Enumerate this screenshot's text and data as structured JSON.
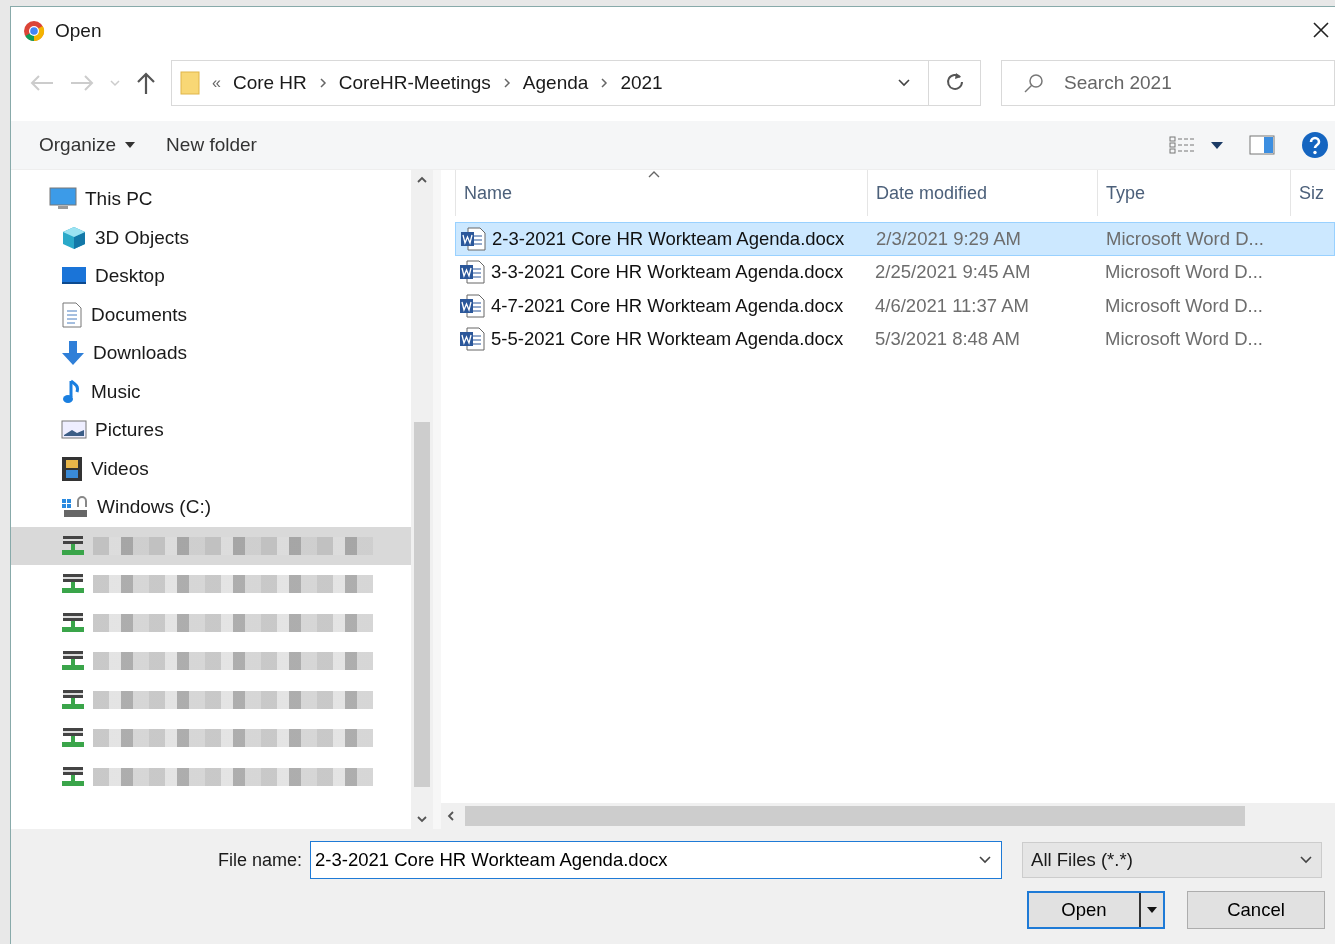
{
  "window": {
    "title": "Open"
  },
  "address": {
    "overflow": "«",
    "crumbs": [
      "Core HR",
      "CoreHR-Meetings",
      "Agenda",
      "2021"
    ]
  },
  "search": {
    "placeholder": "Search 2021"
  },
  "toolbar": {
    "organize": "Organize",
    "new_folder": "New folder"
  },
  "nav_pane": {
    "tree": [
      {
        "label": "This PC",
        "kind": "pc",
        "selected": false,
        "children": [
          {
            "label": "3D Objects",
            "kind": "cube",
            "selected": false
          },
          {
            "label": "Desktop",
            "kind": "desktop",
            "selected": false
          },
          {
            "label": "Documents",
            "kind": "document",
            "selected": false
          },
          {
            "label": "Downloads",
            "kind": "download",
            "selected": false
          },
          {
            "label": "Music",
            "kind": "music",
            "selected": false
          },
          {
            "label": "Pictures",
            "kind": "picture",
            "selected": false
          },
          {
            "label": "Videos",
            "kind": "video",
            "selected": false
          },
          {
            "label": "Windows (C:)",
            "kind": "disk",
            "selected": false
          },
          {
            "kind": "network-drive",
            "redacted": true,
            "selected": true
          },
          {
            "kind": "network-drive",
            "redacted": true,
            "selected": false
          },
          {
            "kind": "network-drive",
            "redacted": true,
            "selected": false
          },
          {
            "kind": "network-drive",
            "redacted": true,
            "selected": false
          },
          {
            "kind": "network-drive",
            "redacted": true,
            "selected": false
          },
          {
            "kind": "network-drive",
            "redacted": true,
            "selected": false
          },
          {
            "kind": "network-drive",
            "redacted": true,
            "selected": false
          }
        ]
      }
    ]
  },
  "files": {
    "columns": [
      "Name",
      "Date modified",
      "Type",
      "Siz"
    ],
    "rows": [
      {
        "name": "2-3-2021 Core HR Workteam Agenda.docx",
        "date": "2/3/2021 9:29 AM",
        "type": "Microsoft Word D...",
        "selected": true
      },
      {
        "name": "3-3-2021 Core HR Workteam Agenda.docx",
        "date": "2/25/2021 9:45 AM",
        "type": "Microsoft Word D...",
        "selected": false
      },
      {
        "name": "4-7-2021 Core HR Workteam Agenda.docx",
        "date": "4/6/2021 11:37 AM",
        "type": "Microsoft Word D...",
        "selected": false
      },
      {
        "name": "5-5-2021 Core HR Workteam Agenda.docx",
        "date": "5/3/2021 8:48 AM",
        "type": "Microsoft Word D...",
        "selected": false
      }
    ]
  },
  "bottom": {
    "file_name_label": "File name:",
    "file_name": "2-3-2021 Core HR Workteam Agenda.docx",
    "filter": "All Files (*.*)",
    "buttons": [
      "Open",
      "Cancel"
    ]
  }
}
